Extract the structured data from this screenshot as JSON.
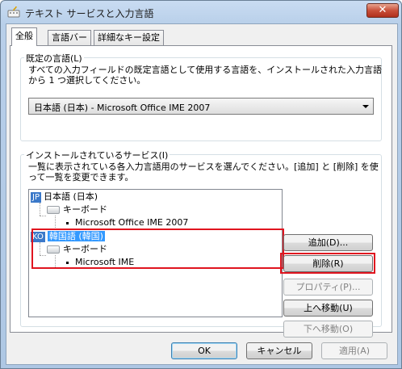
{
  "window": {
    "title": "テキスト サービスと入力言語",
    "close_label": "✕"
  },
  "tabs": [
    {
      "label": "全般",
      "active": true
    },
    {
      "label": "言語バー",
      "active": false
    },
    {
      "label": "詳細なキー設定",
      "active": false
    }
  ],
  "default_language": {
    "group_label": "既定の言語(L)",
    "description_line1": "すべての入力フィールドの既定言語として使用する言語を、インストールされた入力言語",
    "description_line2": "から 1 つ選択してください。",
    "selected_value": "日本語 (日本) - Microsoft Office IME 2007"
  },
  "installed_services": {
    "group_label": "インストールされているサービス(I)",
    "description_line1": "一覧に表示されている各入力言語用のサービスを選んでください。[追加] と [削除] を使",
    "description_line2": "って一覧を変更できます。",
    "tree": {
      "lang1": {
        "badge": "JP",
        "label": "日本語 (日本)",
        "category": "キーボード",
        "service": "Microsoft Office IME 2007"
      },
      "lang2": {
        "badge": "KO",
        "label": "韓国語 (韓国)",
        "category": "キーボード",
        "service": "Microsoft IME",
        "selected": true
      }
    },
    "buttons": {
      "add": "追加(D)...",
      "remove": "削除(R)",
      "properties": "プロパティ(P)...",
      "move_up": "上へ移動(U)",
      "move_down": "下へ移動(O)"
    }
  },
  "footer": {
    "ok": "OK",
    "cancel": "キャンセル",
    "apply": "適用(A)"
  },
  "highlight_color": "#e0151f",
  "selection_color": "#3399ff"
}
